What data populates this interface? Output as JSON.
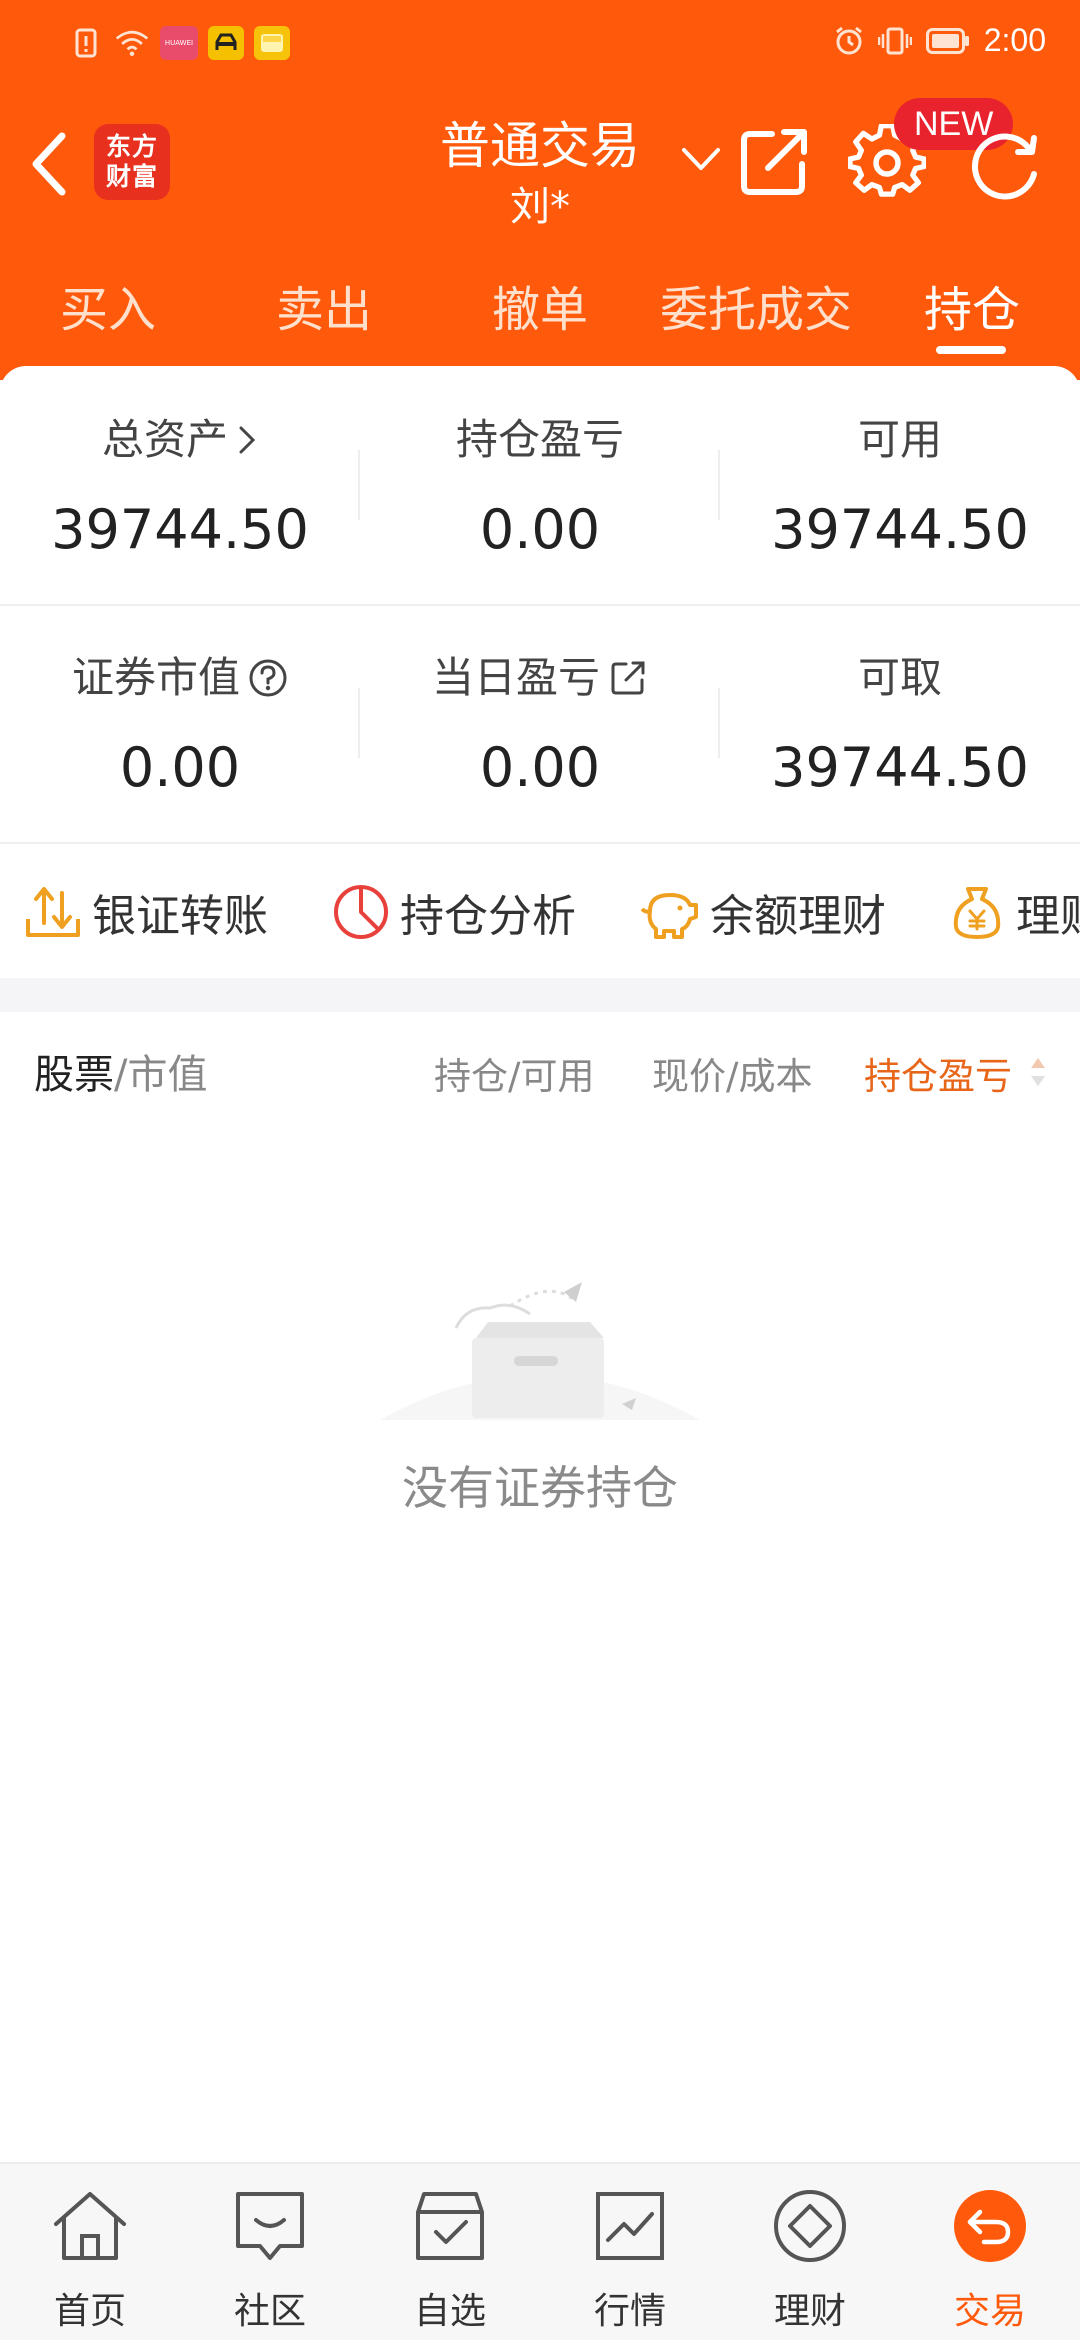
{
  "status_bar": {
    "time": "2:00",
    "carrier_badge": "HUAWEI"
  },
  "header": {
    "logo_text_line1": "东方",
    "logo_text_line2": "财富",
    "title": "普通交易",
    "account": "刘*",
    "new_badge": "NEW",
    "accent_color": "#FF5A0C"
  },
  "tabs": [
    {
      "label": "买入"
    },
    {
      "label": "卖出"
    },
    {
      "label": "撤单"
    },
    {
      "label": "委托成交"
    },
    {
      "label": "持仓",
      "active": true
    }
  ],
  "summary": {
    "total_assets": {
      "label": "总资产",
      "value": "39744.50"
    },
    "position_pnl": {
      "label": "持仓盈亏",
      "value": "0.00"
    },
    "available": {
      "label": "可用",
      "value": "39744.50"
    },
    "securities_value": {
      "label": "证券市值",
      "value": "0.00"
    },
    "daily_pnl": {
      "label": "当日盈亏",
      "value": "0.00"
    },
    "withdrawable": {
      "label": "可取",
      "value": "39744.50"
    }
  },
  "quick_actions": [
    {
      "label": "银证转账",
      "icon": "transfer-icon"
    },
    {
      "label": "持仓分析",
      "icon": "pie-chart-icon"
    },
    {
      "label": "余额理财",
      "icon": "piggy-bank-icon"
    },
    {
      "label": "理财",
      "icon": "money-bag-icon"
    }
  ],
  "list_header": {
    "stock": "股票",
    "stock_suffix": "/市值",
    "holding": "持仓/可用",
    "price": "现价/成本",
    "pnl": "持仓盈亏"
  },
  "empty_state": {
    "text": "没有证券持仓"
  },
  "bottom_nav": [
    {
      "label": "首页",
      "icon": "home-icon"
    },
    {
      "label": "社区",
      "icon": "community-icon"
    },
    {
      "label": "自选",
      "icon": "watchlist-icon"
    },
    {
      "label": "行情",
      "icon": "market-chart-icon"
    },
    {
      "label": "理财",
      "icon": "wealth-icon"
    },
    {
      "label": "交易",
      "icon": "trade-icon",
      "active": true
    }
  ]
}
